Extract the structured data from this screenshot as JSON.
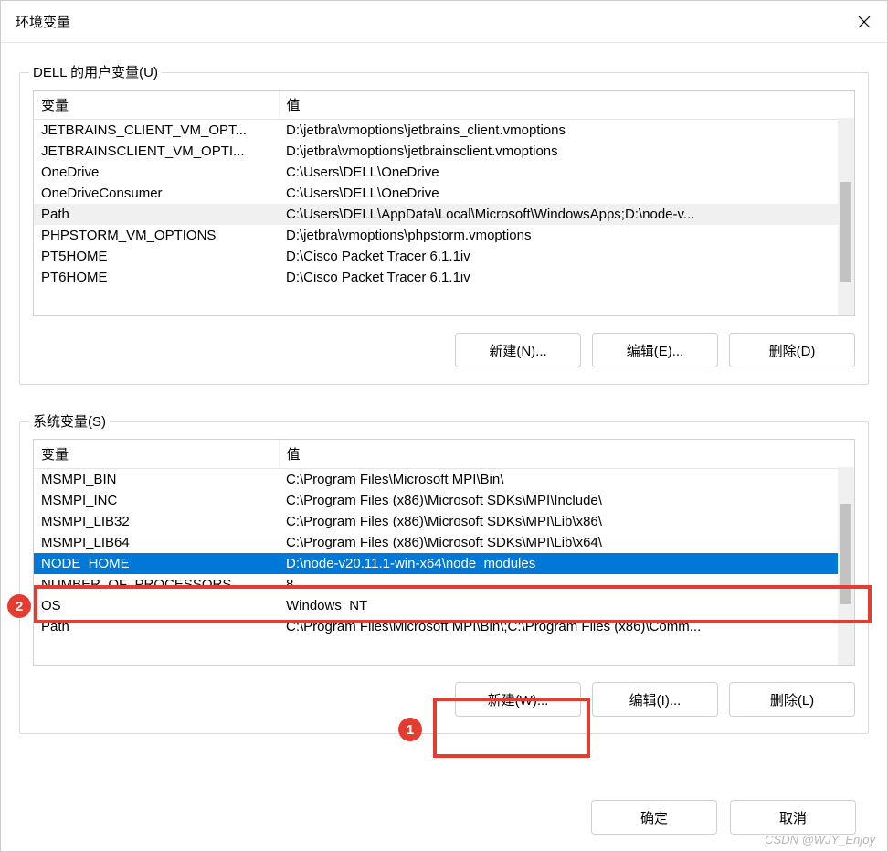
{
  "window": {
    "title": "环境变量"
  },
  "userVars": {
    "legend": "DELL 的用户变量(U)",
    "headers": {
      "var": "变量",
      "val": "值"
    },
    "rows": [
      {
        "var": "JETBRAINS_CLIENT_VM_OPT...",
        "val": "D:\\jetbra\\vmoptions\\jetbrains_client.vmoptions",
        "selected": false
      },
      {
        "var": "JETBRAINSCLIENT_VM_OPTI...",
        "val": "D:\\jetbra\\vmoptions\\jetbrainsclient.vmoptions",
        "selected": false
      },
      {
        "var": "OneDrive",
        "val": "C:\\Users\\DELL\\OneDrive",
        "selected": false
      },
      {
        "var": "OneDriveConsumer",
        "val": "C:\\Users\\DELL\\OneDrive",
        "selected": false
      },
      {
        "var": "Path",
        "val": "C:\\Users\\DELL\\AppData\\Local\\Microsoft\\WindowsApps;D:\\node-v...",
        "selected": true
      },
      {
        "var": "PHPSTORM_VM_OPTIONS",
        "val": "D:\\jetbra\\vmoptions\\phpstorm.vmoptions",
        "selected": false
      },
      {
        "var": "PT5HOME",
        "val": "D:\\Cisco Packet Tracer 6.1.1iv",
        "selected": false
      },
      {
        "var": "PT6HOME",
        "val": "D:\\Cisco Packet Tracer 6.1.1iv",
        "selected": false
      }
    ],
    "buttons": {
      "new": "新建(N)...",
      "edit": "编辑(E)...",
      "delete": "删除(D)"
    }
  },
  "sysVars": {
    "legend": "系统变量(S)",
    "headers": {
      "var": "变量",
      "val": "值"
    },
    "rows": [
      {
        "var": "MSMPI_BIN",
        "val": "C:\\Program Files\\Microsoft MPI\\Bin\\",
        "selected": false
      },
      {
        "var": "MSMPI_INC",
        "val": "C:\\Program Files (x86)\\Microsoft SDKs\\MPI\\Include\\",
        "selected": false
      },
      {
        "var": "MSMPI_LIB32",
        "val": "C:\\Program Files (x86)\\Microsoft SDKs\\MPI\\Lib\\x86\\",
        "selected": false
      },
      {
        "var": "MSMPI_LIB64",
        "val": "C:\\Program Files (x86)\\Microsoft SDKs\\MPI\\Lib\\x64\\",
        "selected": false
      },
      {
        "var": "NODE_HOME",
        "val": "D:\\node-v20.11.1-win-x64\\node_modules",
        "selected": true
      },
      {
        "var": "NUMBER_OF_PROCESSORS",
        "val": "8",
        "selected": false
      },
      {
        "var": "OS",
        "val": "Windows_NT",
        "selected": false
      },
      {
        "var": "Path",
        "val": "C:\\Program Files\\Microsoft MPI\\Bin\\;C:\\Program Files (x86)\\Comm...",
        "selected": false
      }
    ],
    "buttons": {
      "new": "新建(W)...",
      "edit": "编辑(I)...",
      "delete": "删除(L)"
    }
  },
  "footer": {
    "ok": "确定",
    "cancel": "取消"
  },
  "annotations": {
    "one": "1",
    "two": "2"
  },
  "watermark": "CSDN @WJY_Enjoy"
}
